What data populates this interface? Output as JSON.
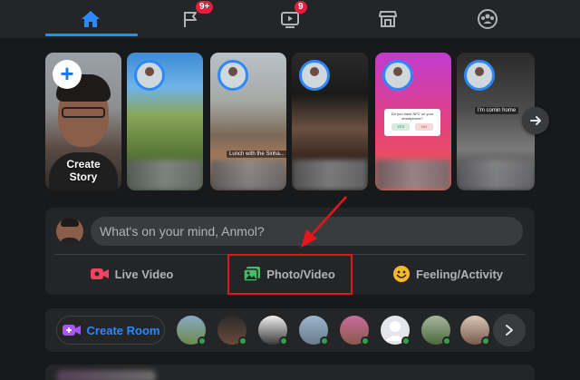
{
  "nav": {
    "tabs": [
      {
        "name": "home",
        "icon": "home-icon",
        "active": true
      },
      {
        "name": "pages",
        "icon": "flag-icon",
        "badge": "9+"
      },
      {
        "name": "watch",
        "icon": "video-icon",
        "badge": "9"
      },
      {
        "name": "marketplace",
        "icon": "store-icon"
      },
      {
        "name": "groups",
        "icon": "groups-icon"
      }
    ],
    "accent": "#2d88ff",
    "badge_color": "#e41e3f"
  },
  "stories": {
    "create_label_line1": "Create",
    "create_label_line2": "Story",
    "captions": {
      "story3": "Lunch with the Sinha...",
      "story4_question": "Do you have NFC on your smartphone?",
      "story4_yes": "YES",
      "story4_no": "NO",
      "story5": "I'm comin home"
    }
  },
  "composer": {
    "placeholder": "What's on your mind, Anmol?",
    "live_video": "Live Video",
    "photo_video": "Photo/Video",
    "feeling": "Feeling/Activity",
    "colors": {
      "live": "#f3425f",
      "photo": "#45bd62",
      "feeling": "#f7b928"
    }
  },
  "rooms": {
    "create_room": "Create Room",
    "room_color": "#a855f7",
    "online_color": "#31a24c"
  }
}
